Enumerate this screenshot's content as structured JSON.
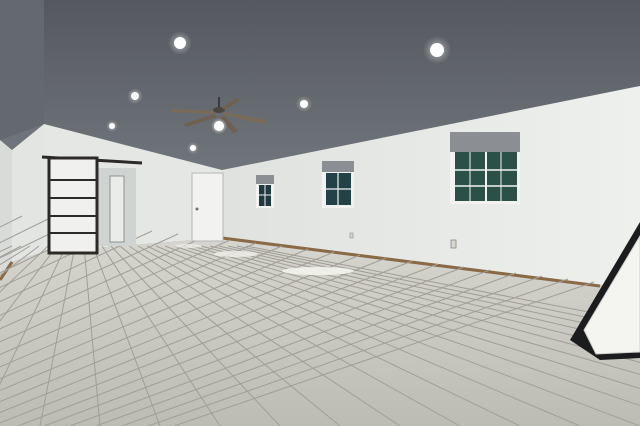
{
  "scene": {
    "description_visible_text": "",
    "colors": {
      "ceiling": "#5f646a",
      "wall": "#e9ebe8",
      "wall_shade": "#cfd3d1",
      "floor": "#c9c8c0",
      "floor_grout": "#9c9a92",
      "baseboard": "#8a6a44",
      "window_glass": "#1f3a3f",
      "window_frame": "#f2f2f0",
      "blind": "#8b8f94",
      "door": "#f0f0ee",
      "barn_door_frame": "#2c2a27",
      "light": "#ffffff"
    },
    "icons": [
      "ceiling-fan-icon",
      "recessed-light-icon",
      "window-icon",
      "barn-door-icon",
      "mattress-icon"
    ]
  }
}
